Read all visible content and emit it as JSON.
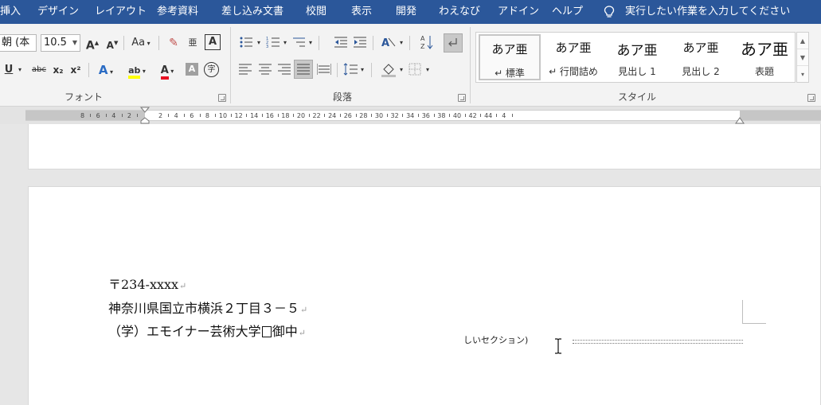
{
  "menu": {
    "items": [
      "挿入",
      "デザイン",
      "レイアウト",
      "参考資料",
      "差し込み文書",
      "校閲",
      "表示",
      "開発",
      "わえなび",
      "アドイン",
      "ヘルプ"
    ],
    "tell_me": "実行したい作業を入力してください"
  },
  "font": {
    "name": "朝 (本",
    "size": "10.5",
    "grow": "A",
    "shrink": "A",
    "case": "Aa",
    "clear_glyph": "✎",
    "ruby": "亜",
    "border_char": "A",
    "underline": "U",
    "strike": "abc",
    "subscript": "x₂",
    "superscript": "x²",
    "effects": "A",
    "highlight": "ab",
    "color": "A",
    "shade": "A",
    "circled": "字",
    "group_label": "フォント"
  },
  "paragraph": {
    "group_label": "段落"
  },
  "styles": {
    "group_label": "スタイル",
    "items": [
      {
        "sample": "あア亜",
        "name": "↵ 標準"
      },
      {
        "sample": "あア亜",
        "name": "↵ 行間詰め"
      },
      {
        "sample": "あア亜",
        "name": "見出し 1"
      },
      {
        "sample": "あア亜",
        "name": "見出し 2"
      },
      {
        "sample": "あア亜",
        "name": "表題"
      }
    ]
  },
  "ruler": {
    "labels": [
      "8",
      "6",
      "4",
      "2",
      "2",
      "4",
      "6",
      "8",
      "10",
      "12",
      "14",
      "16",
      "18",
      "20",
      "22",
      "24",
      "26",
      "28",
      "30",
      "32",
      "34",
      "36",
      "38",
      "40",
      "42",
      "44",
      "4"
    ]
  },
  "document": {
    "lines": [
      "〒234-xxxx",
      "神奈川県国立市横浜２丁目３－５",
      "（学）エモイナー芸術大学",
      "御中"
    ],
    "section_label": "しいセクション)"
  },
  "colors": {
    "title_bar": "#2b579a",
    "ribbon": "#f3f3f3",
    "font_color": "#e81123",
    "highlight": "#ffff00"
  }
}
